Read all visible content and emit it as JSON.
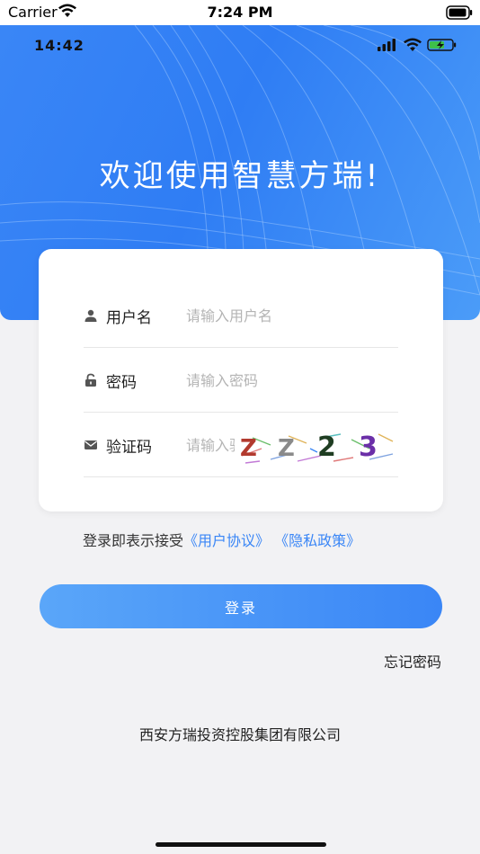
{
  "system_status": {
    "carrier": "Carrier",
    "time": "7:24 PM"
  },
  "app_status": {
    "time": "14:42"
  },
  "header": {
    "welcome": "欢迎使用智慧方瑞!"
  },
  "form": {
    "username": {
      "label": "用户名",
      "placeholder": "请输入用户名",
      "icon": "user-icon"
    },
    "password": {
      "label": "密码",
      "placeholder": "请输入密码",
      "icon": "lock-icon"
    },
    "captcha": {
      "label": "验证码",
      "placeholder": "请输入验证码",
      "icon": "envelope-icon",
      "code": [
        "Z",
        "Z",
        "2",
        "3"
      ]
    }
  },
  "agreement": {
    "prefix": "登录即表示接受",
    "user_agreement": "《用户协议》",
    "privacy_policy": "《隐私政策》"
  },
  "login_button": "登录",
  "forgot_password": "忘记密码",
  "footer": {
    "company": "西安方瑞投资控股集团有限公司"
  },
  "colors": {
    "primary": "#3a86f6",
    "button_start": "#5aa6f9",
    "background": "#f2f2f4"
  }
}
